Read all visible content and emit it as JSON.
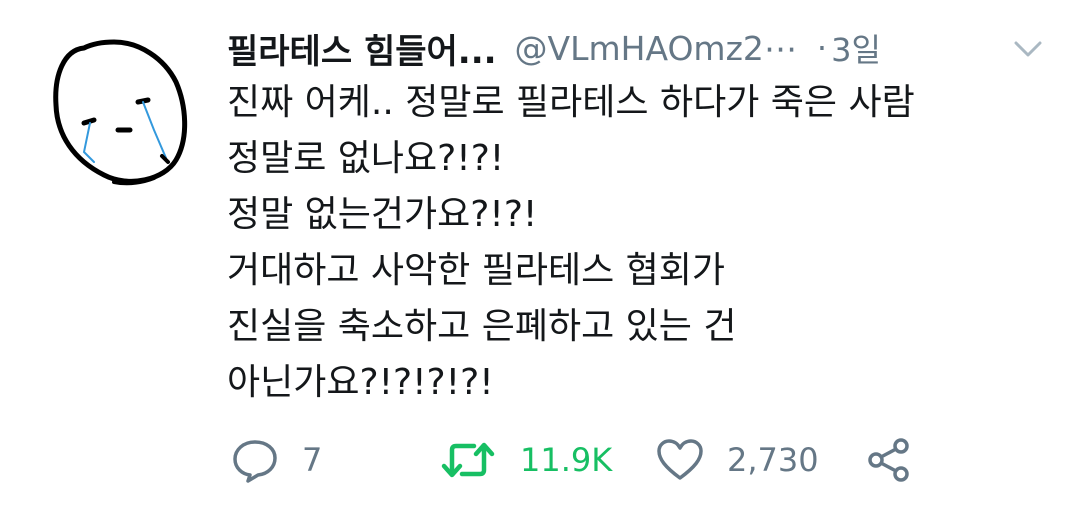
{
  "tweet": {
    "display_name": "필라테스 힘들어...",
    "handle": "@VLmHAOmz2⋯",
    "dot": "·",
    "time": "3일",
    "body_lines": [
      "진짜 어케.. 정말로 필라테스 하다가 죽은 사람",
      "정말로 없나요?!?!",
      "정말 없는건가요?!?!",
      "거대하고 사악한 필라테스 협회가",
      "진실을 축소하고 은폐하고 있는 건",
      "아닌가요?!?!?!?!"
    ]
  },
  "actions": {
    "reply": {
      "icon": "reply-icon",
      "count": "7"
    },
    "retweet": {
      "icon": "retweet-icon",
      "count": "11.9K",
      "color": "#17bf63"
    },
    "like": {
      "icon": "heart-icon",
      "count": "2,730"
    },
    "share": {
      "icon": "share-icon"
    }
  },
  "colors": {
    "text": "#14171a",
    "secondary": "#657786",
    "retweeted": "#17bf63",
    "background": "#ffffff"
  }
}
